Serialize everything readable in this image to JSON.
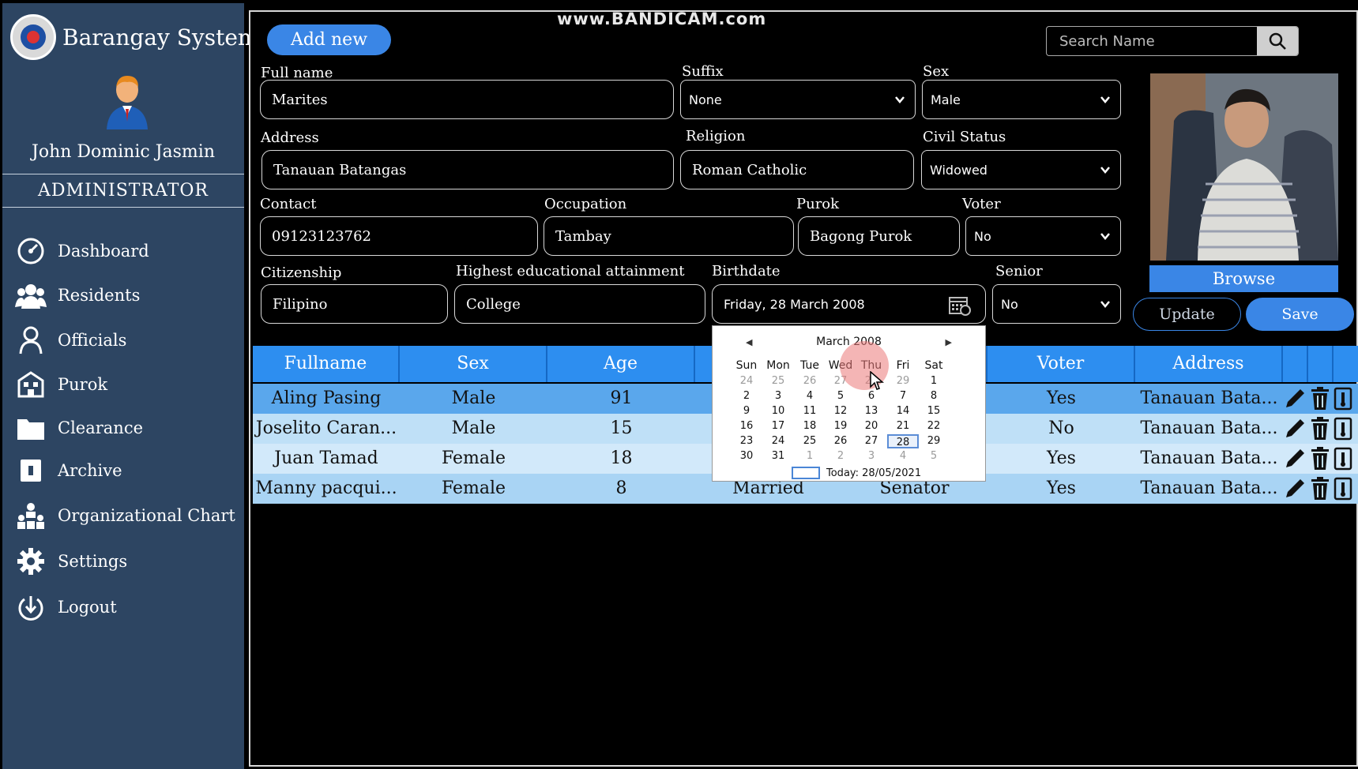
{
  "app": {
    "title": "Barangay System",
    "watermark": "www.BANDICAM.com"
  },
  "user": {
    "name": "John Dominic Jasmin",
    "role": "ADMINISTRATOR"
  },
  "sidebar": {
    "items": [
      {
        "label": "Dashboard",
        "icon": "dashboard-gauge-icon"
      },
      {
        "label": "Residents",
        "icon": "residents-group-icon"
      },
      {
        "label": "Officials",
        "icon": "officials-person-icon"
      },
      {
        "label": "Purok",
        "icon": "purok-building-icon"
      },
      {
        "label": "Clearance",
        "icon": "clearance-folder-icon"
      },
      {
        "label": "Archive",
        "icon": "archive-book-icon"
      },
      {
        "label": "Organizational Chart",
        "icon": "org-chart-icon"
      },
      {
        "label": "Settings",
        "icon": "gear-icon"
      },
      {
        "label": "Logout",
        "icon": "logout-icon"
      }
    ]
  },
  "toolbar": {
    "add_label": "Add new",
    "search_placeholder": "Search Name"
  },
  "form": {
    "full_name_label": "Full name",
    "full_name": "Marites",
    "suffix_label": "Suffix",
    "suffix": "None",
    "sex_label": "Sex",
    "sex": "Male",
    "address_label": "Address",
    "address": "Tanauan Batangas",
    "religion_label": "Religion",
    "religion": "Roman Catholic",
    "civil_status_label": "Civil Status",
    "civil_status": "Widowed",
    "contact_label": "Contact",
    "contact": "09123123762",
    "occupation_label": "Occupation",
    "occupation": "Tambay",
    "purok_label": "Purok",
    "purok": "Bagong Purok",
    "voter_label": "Voter",
    "voter": "No",
    "citizenship_label": "Citizenship",
    "citizenship": "Filipino",
    "education_label": "Highest educational attainment",
    "education": "College",
    "birthdate_label": "Birthdate",
    "birthdate": "Friday, 28 March 2008",
    "senior_label": "Senior",
    "senior": "No"
  },
  "buttons": {
    "browse": "Browse",
    "update": "Update",
    "save": "Save"
  },
  "table": {
    "headers": [
      "Fullname",
      "Sex",
      "Age",
      "Voter",
      "Address"
    ],
    "rows": [
      {
        "fullname": "Aling Pasing",
        "sex": "Male",
        "age": "91",
        "civil": "",
        "occupation": "",
        "voter": "Yes",
        "address": "Tanauan Bata..."
      },
      {
        "fullname": "Joselito Caran...",
        "sex": "Male",
        "age": "15",
        "civil": "",
        "occupation": "",
        "voter": "No",
        "address": "Tanauan Bata..."
      },
      {
        "fullname": "Juan Tamad",
        "sex": "Female",
        "age": "18",
        "civil": "",
        "occupation": "",
        "voter": "Yes",
        "address": "Tanauan Bata..."
      },
      {
        "fullname": "Manny pacqui...",
        "sex": "Female",
        "age": "8",
        "civil": "Married",
        "occupation": "Senator",
        "voter": "Yes",
        "address": "Tanauan Bata..."
      }
    ],
    "row_colors": [
      "#5aa7ec",
      "#bfe0f7",
      "#d2e9fa",
      "#a9d4f4"
    ]
  },
  "calendar": {
    "month": "March 2008",
    "dow": [
      "Sun",
      "Mon",
      "Tue",
      "Wed",
      "Thu",
      "Fri",
      "Sat"
    ],
    "weeks": [
      [
        "24",
        "25",
        "26",
        "27",
        "28",
        "29",
        "1"
      ],
      [
        "2",
        "3",
        "4",
        "5",
        "6",
        "7",
        "8"
      ],
      [
        "9",
        "10",
        "11",
        "12",
        "13",
        "14",
        "15"
      ],
      [
        "16",
        "17",
        "18",
        "19",
        "20",
        "21",
        "22"
      ],
      [
        "23",
        "24",
        "25",
        "26",
        "27",
        "28",
        "29"
      ],
      [
        "30",
        "31",
        "1",
        "2",
        "3",
        "4",
        "5"
      ]
    ],
    "selected": "28",
    "today": "Today: 28/05/2021"
  },
  "colors": {
    "sidebar": "#2d4562",
    "accent": "#3a86e6",
    "header": "#2d8ef0"
  }
}
